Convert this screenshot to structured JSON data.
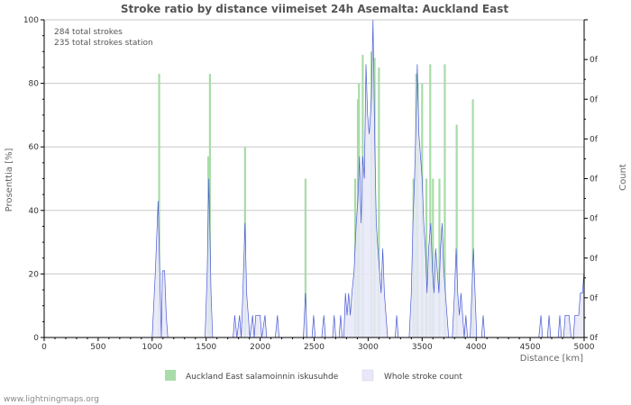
{
  "chart_data": {
    "type": "bar",
    "title": "Stroke ratio by distance viimeiset 24h Asemalta: Auckland East",
    "xlabel": "Distance   [km]",
    "ylabel_left": "Prosenttia   [%]",
    "ylabel_right": "Count",
    "xlim": [
      0,
      5000
    ],
    "ylim": [
      0,
      100
    ],
    "x_ticks": [
      0,
      500,
      1000,
      1500,
      2000,
      2500,
      3000,
      3500,
      4000,
      4500,
      5000
    ],
    "y_ticks": [
      0,
      20,
      40,
      60,
      80,
      100
    ],
    "right_ticks": [
      "0f",
      "0f",
      "0f",
      "0f",
      "0f",
      "0f",
      "0f",
      "0f"
    ],
    "info_lines": [
      "284 total strokes",
      "235 total strokes station"
    ],
    "grid": true,
    "legend_position": "bottom",
    "series": [
      {
        "name": "Auckland East salamoinnin iskusuhde",
        "kind": "bar",
        "color": "#a8dca8",
        "points": [
          [
            1065,
            83
          ],
          [
            1520,
            57
          ],
          [
            1535,
            83
          ],
          [
            1860,
            60
          ],
          [
            2420,
            50
          ],
          [
            2880,
            50
          ],
          [
            2905,
            75
          ],
          [
            2915,
            80
          ],
          [
            2950,
            89
          ],
          [
            3030,
            90
          ],
          [
            3060,
            88
          ],
          [
            3100,
            85
          ],
          [
            3420,
            50
          ],
          [
            3445,
            83
          ],
          [
            3460,
            80
          ],
          [
            3500,
            80
          ],
          [
            3540,
            50
          ],
          [
            3575,
            86
          ],
          [
            3600,
            50
          ],
          [
            3660,
            50
          ],
          [
            3710,
            86
          ],
          [
            3820,
            67
          ],
          [
            3970,
            75
          ]
        ]
      },
      {
        "name": "Whole stroke count",
        "kind": "area",
        "color": "#4a5bd4",
        "fill": "#e8e8f8",
        "points": [
          [
            1000,
            0
          ],
          [
            1030,
            21
          ],
          [
            1055,
            43
          ],
          [
            1075,
            14
          ],
          [
            1085,
            0
          ],
          [
            1095,
            21
          ],
          [
            1115,
            21
          ],
          [
            1130,
            7
          ],
          [
            1145,
            0
          ],
          [
            1490,
            0
          ],
          [
            1510,
            21
          ],
          [
            1525,
            50
          ],
          [
            1545,
            14
          ],
          [
            1560,
            0
          ],
          [
            1750,
            0
          ],
          [
            1765,
            7
          ],
          [
            1785,
            0
          ],
          [
            1810,
            7
          ],
          [
            1825,
            0
          ],
          [
            1840,
            14
          ],
          [
            1860,
            36
          ],
          [
            1875,
            14
          ],
          [
            1890,
            7
          ],
          [
            1905,
            0
          ],
          [
            1930,
            7
          ],
          [
            1945,
            0
          ],
          [
            1960,
            7
          ],
          [
            2000,
            7
          ],
          [
            2015,
            0
          ],
          [
            2045,
            7
          ],
          [
            2060,
            0
          ],
          [
            2140,
            0
          ],
          [
            2160,
            7
          ],
          [
            2175,
            0
          ],
          [
            2400,
            0
          ],
          [
            2420,
            14
          ],
          [
            2435,
            0
          ],
          [
            2480,
            0
          ],
          [
            2495,
            7
          ],
          [
            2510,
            0
          ],
          [
            2570,
            0
          ],
          [
            2590,
            7
          ],
          [
            2605,
            0
          ],
          [
            2670,
            0
          ],
          [
            2685,
            7
          ],
          [
            2700,
            0
          ],
          [
            2730,
            0
          ],
          [
            2745,
            7
          ],
          [
            2760,
            0
          ],
          [
            2775,
            0
          ],
          [
            2790,
            14
          ],
          [
            2805,
            7
          ],
          [
            2820,
            14
          ],
          [
            2835,
            7
          ],
          [
            2850,
            14
          ],
          [
            2870,
            21
          ],
          [
            2890,
            36
          ],
          [
            2905,
            43
          ],
          [
            2920,
            57
          ],
          [
            2935,
            36
          ],
          [
            2950,
            57
          ],
          [
            2965,
            50
          ],
          [
            2980,
            86
          ],
          [
            2995,
            70
          ],
          [
            3010,
            64
          ],
          [
            3030,
            75
          ],
          [
            3045,
            100
          ],
          [
            3060,
            64
          ],
          [
            3075,
            36
          ],
          [
            3090,
            28
          ],
          [
            3105,
            21
          ],
          [
            3120,
            14
          ],
          [
            3135,
            28
          ],
          [
            3150,
            14
          ],
          [
            3165,
            7
          ],
          [
            3180,
            0
          ],
          [
            3250,
            0
          ],
          [
            3265,
            7
          ],
          [
            3280,
            0
          ],
          [
            3380,
            0
          ],
          [
            3400,
            14
          ],
          [
            3415,
            36
          ],
          [
            3430,
            50
          ],
          [
            3445,
            70
          ],
          [
            3455,
            86
          ],
          [
            3470,
            64
          ],
          [
            3485,
            57
          ],
          [
            3500,
            50
          ],
          [
            3515,
            36
          ],
          [
            3530,
            28
          ],
          [
            3545,
            14
          ],
          [
            3560,
            28
          ],
          [
            3580,
            36
          ],
          [
            3595,
            21
          ],
          [
            3610,
            14
          ],
          [
            3625,
            28
          ],
          [
            3640,
            21
          ],
          [
            3655,
            14
          ],
          [
            3670,
            28
          ],
          [
            3685,
            36
          ],
          [
            3700,
            21
          ],
          [
            3715,
            14
          ],
          [
            3730,
            7
          ],
          [
            3745,
            0
          ],
          [
            3780,
            0
          ],
          [
            3800,
            14
          ],
          [
            3815,
            28
          ],
          [
            3830,
            14
          ],
          [
            3845,
            7
          ],
          [
            3860,
            14
          ],
          [
            3875,
            7
          ],
          [
            3890,
            0
          ],
          [
            3905,
            7
          ],
          [
            3920,
            0
          ],
          [
            3945,
            0
          ],
          [
            3960,
            14
          ],
          [
            3975,
            28
          ],
          [
            3990,
            14
          ],
          [
            4005,
            0
          ],
          [
            4050,
            0
          ],
          [
            4065,
            7
          ],
          [
            4080,
            0
          ],
          [
            4580,
            0
          ],
          [
            4600,
            7
          ],
          [
            4615,
            0
          ],
          [
            4660,
            0
          ],
          [
            4675,
            7
          ],
          [
            4690,
            0
          ],
          [
            4760,
            0
          ],
          [
            4775,
            7
          ],
          [
            4790,
            0
          ],
          [
            4810,
            0
          ],
          [
            4825,
            7
          ],
          [
            4860,
            7
          ],
          [
            4880,
            0
          ],
          [
            4900,
            0
          ],
          [
            4915,
            7
          ],
          [
            4950,
            7
          ],
          [
            4965,
            14
          ],
          [
            4985,
            14
          ],
          [
            5000,
            21
          ]
        ]
      }
    ]
  },
  "credit": "www.lightningmaps.org"
}
